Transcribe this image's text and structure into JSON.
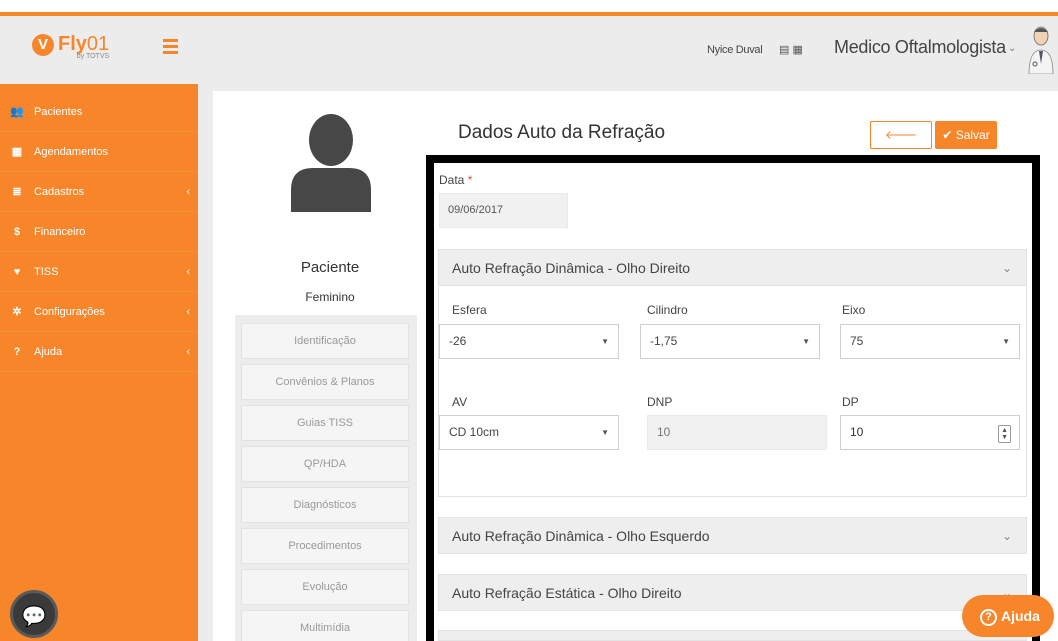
{
  "brand": {
    "logo_mark": "V",
    "logo_fly": "Fly",
    "logo_01": "01",
    "logo_by": "by TOTVS",
    "accent": "#f7862b"
  },
  "sidebar": {
    "items": [
      {
        "label": "Pacientes",
        "icon": "users-icon",
        "glyph": "👥",
        "has_sub": false
      },
      {
        "label": "Agendamentos",
        "icon": "calendar-icon",
        "glyph": "▦",
        "has_sub": false
      },
      {
        "label": "Cadastros",
        "icon": "list-icon",
        "glyph": "≣",
        "has_sub": true
      },
      {
        "label": "Financeiro",
        "icon": "dollar-icon",
        "glyph": "$",
        "has_sub": false
      },
      {
        "label": "TISS",
        "icon": "heart-icon",
        "glyph": "♥",
        "has_sub": true
      },
      {
        "label": "Configurações",
        "icon": "gear-icon",
        "glyph": "✲",
        "has_sub": true
      },
      {
        "label": "Ajuda",
        "icon": "question-icon",
        "glyph": "?",
        "has_sub": true
      }
    ]
  },
  "header": {
    "user_name": "Nyice Duval",
    "role": "Medico Oftalmologista"
  },
  "patient": {
    "label": "Paciente",
    "gender": "Feminino",
    "tabs": [
      "Identificação",
      "Convênios & Planos",
      "Guias TISS",
      "QP/HDA",
      "Diagnósticos",
      "Procedimentos",
      "Evolução",
      "Multimídia"
    ]
  },
  "form": {
    "title": "Dados Auto da Refração",
    "voltar": "Voltar",
    "salvar": "Salvar",
    "data_label": "Data",
    "data_required": "*",
    "data_value": "09/06/2017",
    "panels": [
      "Auto Refração Dinâmica - Olho Direito",
      "Auto Refração Dinâmica - Olho Esquerdo",
      "Auto Refração Estática - Olho Direito"
    ],
    "fields": {
      "esfera_label": "Esfera",
      "esfera_value": "-26",
      "cilindro_label": "Cilindro",
      "cilindro_value": "-1,75",
      "eixo_label": "Eixo",
      "eixo_value": "75",
      "av_label": "AV",
      "av_value": "CD 10cm",
      "dnp_label": "DNP",
      "dnp_value": "10",
      "dp_label": "DP",
      "dp_value": "10"
    }
  },
  "help": {
    "label": "Ajuda"
  }
}
